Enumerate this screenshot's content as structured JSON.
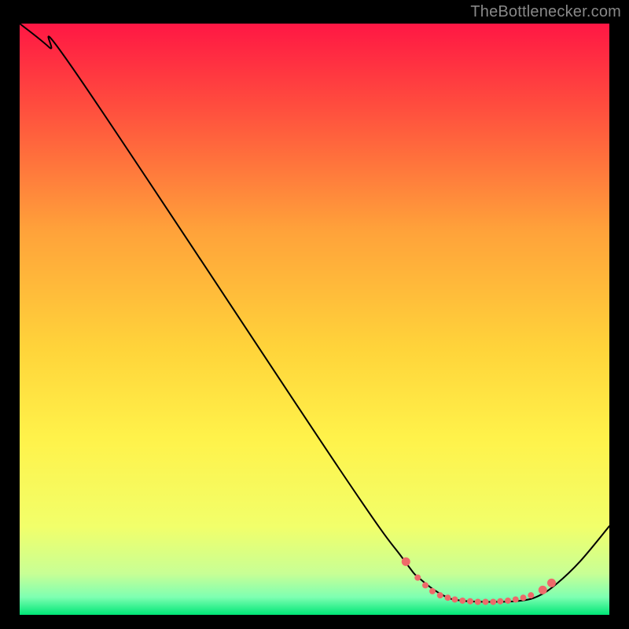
{
  "attribution": "TheBottlenecker.com",
  "chart_data": {
    "type": "line",
    "title": "",
    "xlabel": "",
    "ylabel": "",
    "xlim": [
      0,
      100
    ],
    "ylim": [
      0,
      100
    ],
    "gradient_stops": [
      {
        "pct": 0,
        "color": "#ff1744"
      },
      {
        "pct": 14,
        "color": "#ff4d3e"
      },
      {
        "pct": 35,
        "color": "#ffa23a"
      },
      {
        "pct": 55,
        "color": "#ffd43a"
      },
      {
        "pct": 70,
        "color": "#fff24a"
      },
      {
        "pct": 85,
        "color": "#f2ff6a"
      },
      {
        "pct": 93,
        "color": "#c8ff95"
      },
      {
        "pct": 97,
        "color": "#7effb2"
      },
      {
        "pct": 100,
        "color": "#00e676"
      }
    ],
    "series": [
      {
        "name": "curve",
        "color": "#000000",
        "width": 2,
        "close_to_axis": false,
        "points": [
          {
            "x": 0,
            "y": 100
          },
          {
            "x": 5,
            "y": 96
          },
          {
            "x": 10,
            "y": 91
          },
          {
            "x": 54,
            "y": 25
          },
          {
            "x": 65,
            "y": 9.5
          },
          {
            "x": 68,
            "y": 6
          },
          {
            "x": 72,
            "y": 3.2
          },
          {
            "x": 75,
            "y": 2.4
          },
          {
            "x": 80,
            "y": 2.2
          },
          {
            "x": 85,
            "y": 2.4
          },
          {
            "x": 88,
            "y": 3.2
          },
          {
            "x": 91,
            "y": 5.2
          },
          {
            "x": 95,
            "y": 9
          },
          {
            "x": 100,
            "y": 15
          }
        ]
      }
    ],
    "markers": {
      "color": "#ee6a6a",
      "radius_small": 4,
      "radius_large": 5.5,
      "points": [
        {
          "x": 65.5,
          "y": 9.0,
          "r": "large"
        },
        {
          "x": 67.5,
          "y": 6.3,
          "r": "small"
        },
        {
          "x": 68.8,
          "y": 5.0,
          "r": "small"
        },
        {
          "x": 70.0,
          "y": 4.0,
          "r": "small"
        },
        {
          "x": 71.3,
          "y": 3.3,
          "r": "small"
        },
        {
          "x": 72.6,
          "y": 2.9,
          "r": "small"
        },
        {
          "x": 73.8,
          "y": 2.6,
          "r": "small"
        },
        {
          "x": 75.1,
          "y": 2.4,
          "r": "small"
        },
        {
          "x": 76.4,
          "y": 2.3,
          "r": "small"
        },
        {
          "x": 77.7,
          "y": 2.2,
          "r": "small"
        },
        {
          "x": 79.0,
          "y": 2.2,
          "r": "small"
        },
        {
          "x": 80.3,
          "y": 2.2,
          "r": "small"
        },
        {
          "x": 81.5,
          "y": 2.3,
          "r": "small"
        },
        {
          "x": 82.8,
          "y": 2.4,
          "r": "small"
        },
        {
          "x": 84.1,
          "y": 2.6,
          "r": "small"
        },
        {
          "x": 85.4,
          "y": 2.9,
          "r": "small"
        },
        {
          "x": 86.7,
          "y": 3.3,
          "r": "small"
        },
        {
          "x": 88.7,
          "y": 4.2,
          "r": "large"
        },
        {
          "x": 90.2,
          "y": 5.4,
          "r": "large"
        }
      ]
    }
  }
}
